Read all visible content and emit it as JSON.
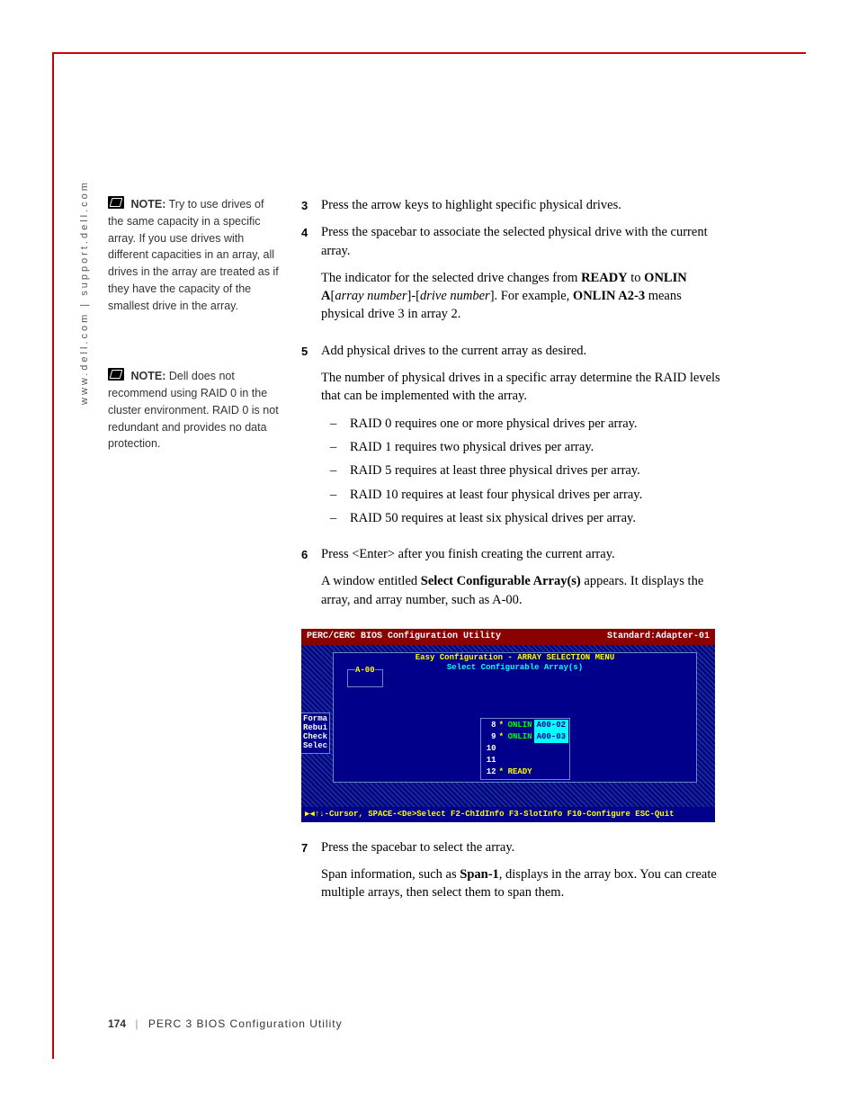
{
  "sidebar_url": "www.dell.com | support.dell.com",
  "notes": [
    {
      "label": "NOTE:",
      "text": "Try to use drives of the same capacity in a specific array. If you use drives with different capacities in an array, all drives in the array are treated as if they have the capacity of the smallest drive in the array."
    },
    {
      "label": "NOTE:",
      "text": "Dell does not recommend using RAID 0 in the cluster environment. RAID 0 is not redundant and provides no data protection."
    }
  ],
  "steps": {
    "s3": {
      "num": "3",
      "body": "Press the arrow keys to highlight specific physical drives."
    },
    "s4": {
      "num": "4",
      "body": "Press the spacebar to associate the selected physical drive with the current array.",
      "para2_a": "The indicator for the selected drive changes from ",
      "para2_b": "READY",
      "para2_c": " to ",
      "para2_d": "ONLIN A",
      "para2_e": "[",
      "para2_f": "array number",
      "para2_g": "]-[",
      "para2_h": "drive number",
      "para2_i": "]. For example, ",
      "para2_j": "ONLIN A2-3",
      "para2_k": " means physical drive 3 in array 2."
    },
    "s5": {
      "num": "5",
      "body": "Add physical drives to the current array as desired.",
      "para2": "The number of physical drives in a specific array determine the RAID levels that can be implemented with the array.",
      "bullets": [
        "RAID 0 requires one or more physical drives per array.",
        "RAID 1 requires two physical drives per array.",
        "RAID 5 requires at least three physical drives per array.",
        "RAID 10 requires at least four physical drives per array.",
        "RAID 50 requires at least six physical drives per array."
      ]
    },
    "s6": {
      "num": "6",
      "body": "Press <Enter> after you finish creating the current array.",
      "para2_a": "A window entitled ",
      "para2_b": "Select Configurable Array(s)",
      "para2_c": " appears. It displays the array, and array number, such as A-00."
    },
    "s7": {
      "num": "7",
      "body": "Press the spacebar to select the array.",
      "para2_a": "Span information, such as ",
      "para2_b": "Span-1",
      "para2_c": ", displays in the array box. You can create multiple arrays, then select them to span them."
    }
  },
  "screenshot": {
    "title_left": "PERC/CERC BIOS Configuration Utility",
    "title_right": "Standard:Adapter-01",
    "win_title": "Easy Configuration - ARRAY SELECTION MENU",
    "win_sub": "Select Configurable Array(s)",
    "a00": "A-00",
    "menu": [
      "Forma",
      "Rebui",
      "Check",
      "Selec"
    ],
    "rows": [
      {
        "n": "8",
        "star": "*",
        "status": "ONLIN",
        "id": "A00-02"
      },
      {
        "n": "9",
        "star": "*",
        "status": "ONLIN",
        "id": "A00-03"
      },
      {
        "n": "10",
        "star": "",
        "status": "",
        "id": ""
      },
      {
        "n": "11",
        "star": "",
        "status": "",
        "id": ""
      },
      {
        "n": "12",
        "star": "*",
        "ready": "READY"
      }
    ],
    "footer": "▶◀↑↓-Cursor, SPACE-<De>Select F2-ChIdInfo F3-SlotInfo F10-Configure ESC-Quit"
  },
  "page_footer": {
    "num": "174",
    "title": "PERC 3 BIOS Configuration Utility"
  }
}
